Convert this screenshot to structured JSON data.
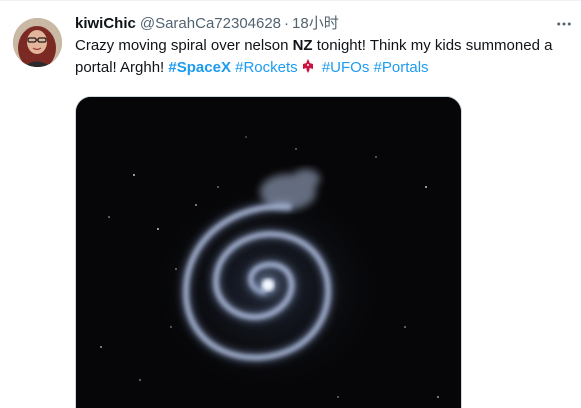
{
  "tweet": {
    "display_name": "kiwiChic",
    "handle": "@SarahCa72304628",
    "separator": "·",
    "timestamp": "18小时",
    "text": {
      "part1": "Crazy moving spiral over nelson ",
      "bold": "NZ",
      "part2": " tonight! Think my kids summoned a portal! Arghh! "
    },
    "hashtags": {
      "spacex": "#SpaceX",
      "rockets": "#Rockets",
      "ufos": "#UFOs",
      "portals": "#Portals"
    },
    "emoji": "houston-rockets-logo",
    "media_alt": "spiral-night-sky-photo"
  },
  "colors": {
    "link": "#1d9bf0",
    "secondary_text": "#536471",
    "primary_text": "#0f1419",
    "emoji_red": "#ce1141"
  },
  "icons": {
    "more": "more-horizontal-icon"
  }
}
